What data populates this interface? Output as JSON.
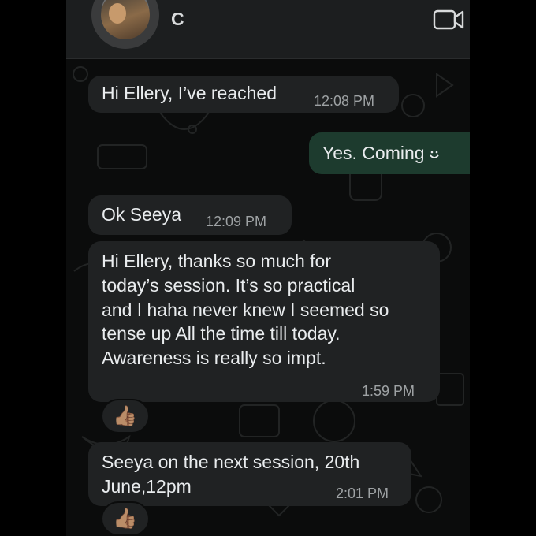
{
  "header": {
    "contact_name": "C",
    "avatar_icon": "contact-avatar",
    "video_icon": "video-call-icon"
  },
  "colors": {
    "incoming_bubble": "#202223",
    "outgoing_bubble": "#1d3b2e",
    "background": "#0b0c0c",
    "text": "#e9ecee",
    "timestamp": "#9ea2a4"
  },
  "messages": [
    {
      "direction": "incoming",
      "text": "Hi Ellery, I’ve reached",
      "time": "12:08 PM"
    },
    {
      "direction": "outgoing",
      "text": "Yes. Coming",
      "emoji": "smile-icon"
    },
    {
      "direction": "incoming",
      "text": "Ok Seeya",
      "time": "12:09 PM"
    },
    {
      "direction": "incoming",
      "lines": [
        "Hi Ellery, thanks so much for",
        "today’s session. It’s so practical",
        "and I haha never knew I seemed so",
        "tense up All the time till today.",
        "Awareness is really so impt."
      ],
      "time": "1:59 PM",
      "reaction": "👍🏽"
    },
    {
      "direction": "incoming",
      "lines": [
        "Seeya on the next session, 20th",
        "June,12pm"
      ],
      "time": "2:01 PM",
      "reaction": "👍🏽"
    }
  ]
}
